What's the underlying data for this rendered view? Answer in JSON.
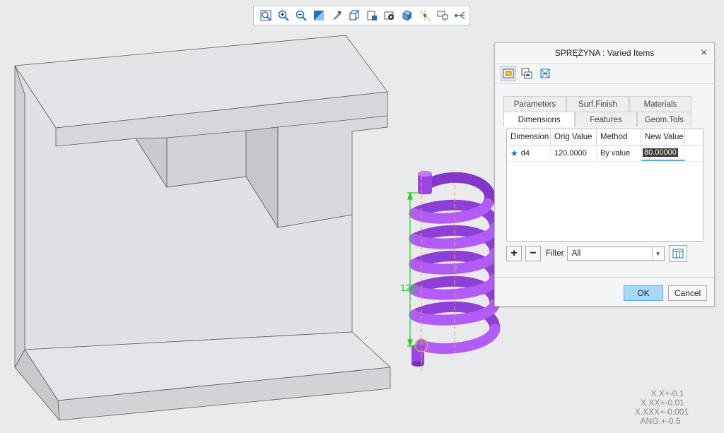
{
  "toolbar": {
    "buttons": [
      {
        "name": "refit-icon"
      },
      {
        "name": "zoom-in-icon"
      },
      {
        "name": "zoom-out-icon"
      },
      {
        "name": "repaint-icon"
      },
      {
        "name": "display-style-icon"
      },
      {
        "name": "saved-orientations-icon"
      },
      {
        "name": "view-manager-icon"
      },
      {
        "name": "perspective-view-icon"
      },
      {
        "name": "section-icon"
      },
      {
        "name": "datum-display-icon"
      },
      {
        "name": "annotation-display-icon"
      },
      {
        "name": "spin-center-icon"
      }
    ]
  },
  "model": {
    "dimension_label": "120",
    "spring_color": "#a54ff0",
    "part_color": "#dcdde0",
    "dimension_color": "#1fd11f"
  },
  "tolerances": [
    "X.X+-0.1",
    "X.XX+-0.01",
    "X.XXX+-0.001",
    "ANG.+-0.5"
  ],
  "dialog": {
    "title": "SPRĘŻYNA : Varied Items",
    "close": "×",
    "tabs_top": [
      "Parameters",
      "Surf.Finish",
      "Materials"
    ],
    "tabs_bottom": [
      "Dimensions",
      "Features",
      "Geom.Tols"
    ],
    "active_tab": "Dimensions",
    "columns": [
      "Dimension",
      "Orig Value",
      "Method",
      "New Value"
    ],
    "rows": [
      {
        "dimension": "d4",
        "orig": "120.0000",
        "method": "By value",
        "new": "80.00000"
      }
    ],
    "add": "+",
    "remove": "−",
    "filter_label": "Filter",
    "filter_value": "All",
    "ok": "OK",
    "cancel": "Cancel"
  }
}
